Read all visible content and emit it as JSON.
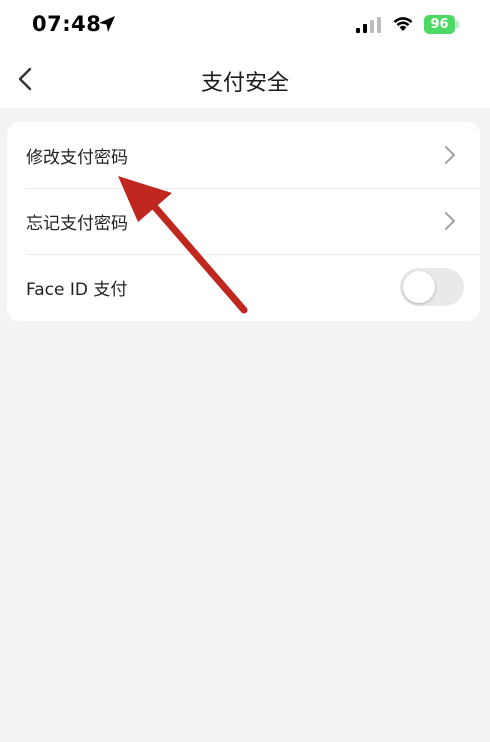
{
  "status_bar": {
    "time": "07:48",
    "battery": "96"
  },
  "nav": {
    "title": "支付安全"
  },
  "settings": {
    "items": [
      {
        "label": "修改支付密码",
        "control": "chevron"
      },
      {
        "label": "忘记支付密码",
        "control": "chevron"
      },
      {
        "label": "Face ID 支付",
        "control": "toggle",
        "enabled": false
      }
    ]
  },
  "colors": {
    "battery": "#4cd964",
    "annotation_arrow": "#c0271f",
    "background": "#f3f3f3"
  }
}
